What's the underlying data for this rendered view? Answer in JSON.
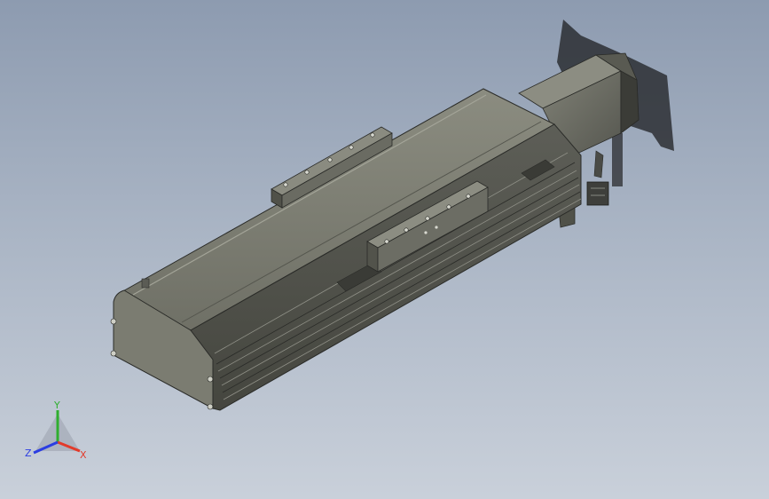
{
  "viewport": {
    "background_top": "#8d9bb0",
    "background_bottom": "#c9d0da"
  },
  "model": {
    "description_icon": "linear-actuator-3d-model",
    "body_color": "#7a7b70",
    "shadow_color": "#4b4c47",
    "edge_color": "#2a2b28"
  },
  "triad": {
    "x_label": "X",
    "y_label": "Y",
    "z_label": "Z",
    "x_color": "#e23b2b",
    "y_color": "#2fae2f",
    "z_color": "#2b3de2"
  }
}
